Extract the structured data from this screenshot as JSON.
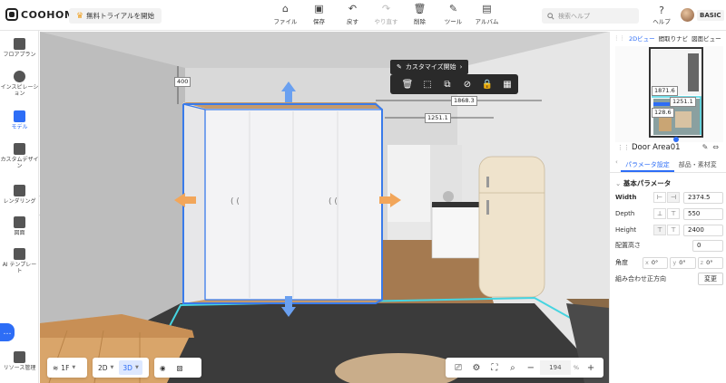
{
  "app": {
    "brand": "COOHOM",
    "trial_button": "無料トライアルを開始"
  },
  "toolbar": [
    {
      "label": "ファイル",
      "icon": "file-icon",
      "glyph": "⌂"
    },
    {
      "label": "保存",
      "icon": "save-icon",
      "glyph": "▣"
    },
    {
      "label": "戻す",
      "icon": "undo-icon",
      "glyph": "↶"
    },
    {
      "label": "やり直す",
      "icon": "redo-icon",
      "glyph": "↷"
    },
    {
      "label": "削除",
      "icon": "delete-icon",
      "glyph": "🗑"
    },
    {
      "label": "ツール",
      "icon": "tool-icon",
      "glyph": "✎"
    },
    {
      "label": "アルバム",
      "icon": "album-icon",
      "glyph": "▤"
    }
  ],
  "search": {
    "placeholder": "検索ヘルプ"
  },
  "help_label": "ヘルプ",
  "user_plan": "BASIC",
  "sidebar": [
    {
      "label": "フロアプラン",
      "icon": "floorplan-icon"
    },
    {
      "label": "インスピレーション",
      "icon": "lightbulb-icon"
    },
    {
      "label": "モデル",
      "icon": "sofa-icon",
      "active": true
    },
    {
      "label": "カスタムデザイン",
      "icon": "custom-design-icon"
    },
    {
      "label": "レンダリング",
      "icon": "camera-icon"
    },
    {
      "label": "図面",
      "icon": "drawing-icon"
    },
    {
      "label": "AI テンプレート",
      "icon": "ai-template-icon"
    },
    {
      "label": "リソース管理",
      "icon": "resource-icon"
    }
  ],
  "viewport": {
    "customize_button": "カスタマイズ開始",
    "context_tools": [
      "delete-icon",
      "select-icon",
      "copy-icon",
      "hide-icon",
      "lock-icon",
      "group-icon"
    ],
    "dimensions": {
      "height_label": "400",
      "depth_label": "1868.3",
      "width_label": "1251.1"
    },
    "floor": {
      "label": "1F"
    },
    "view_2d": "2D",
    "view_3d": "3D",
    "zoom": {
      "value": "194",
      "unit": "%"
    }
  },
  "right_panel": {
    "tabs": [
      "2Dビュー",
      "間取りナビ",
      "図面ビュー"
    ],
    "minimap_labels": [
      "1871.6",
      "1251.1",
      "128.6"
    ],
    "object_name": "Door Area01",
    "prop_tabs": [
      "パラメータ設定",
      "部品・素材変"
    ],
    "section": "基本パラメータ",
    "width": {
      "label": "Width",
      "value": "2374.5"
    },
    "depth": {
      "label": "Depth",
      "value": "550"
    },
    "height": {
      "label": "Height",
      "value": "2400"
    },
    "mount_height": {
      "label": "配置高さ",
      "value": "0"
    },
    "angle": {
      "label": "角度",
      "x": "0°",
      "y": "0°",
      "z": "0°"
    },
    "combine": {
      "label": "組み合わせ正方向",
      "button": "変更"
    }
  },
  "colors": {
    "accent": "#2d6df6",
    "selection": "#3a7bea",
    "floor_edge": "#46d4e0",
    "handle": "#f2a65a"
  }
}
